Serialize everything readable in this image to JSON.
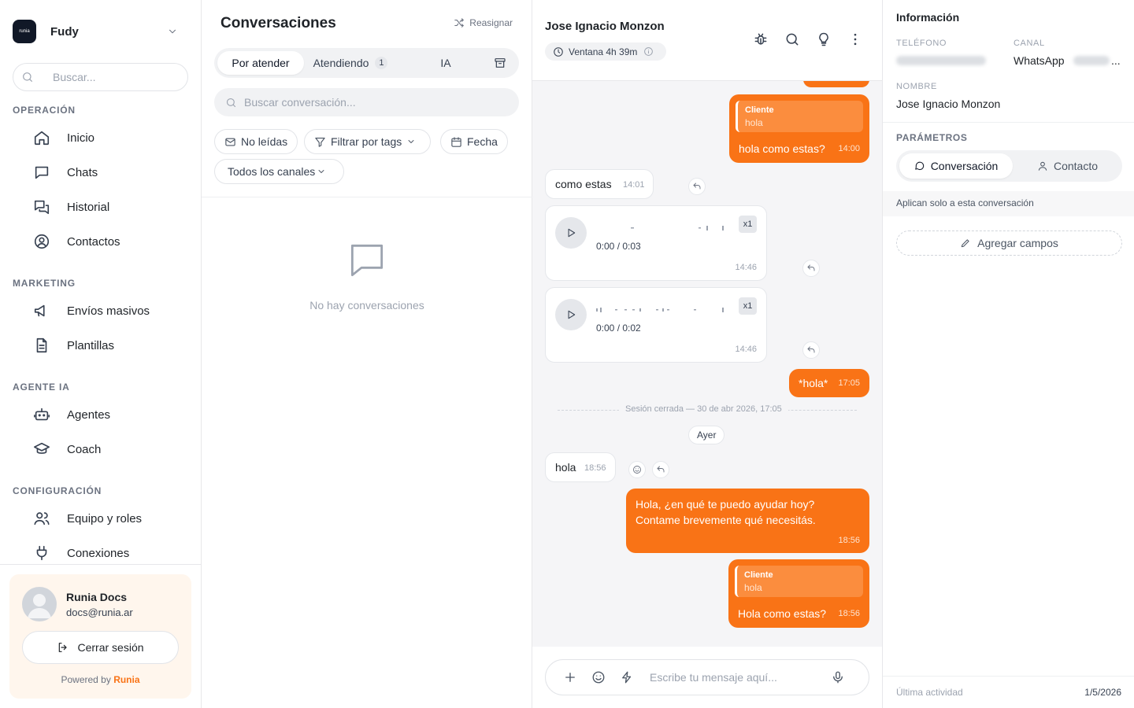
{
  "workspace": {
    "name": "Fudy",
    "logo_text": "runia"
  },
  "sidebar": {
    "search_placeholder": "Buscar...",
    "sections": {
      "operacion": "OPERACIÓN",
      "marketing": "MARKETING",
      "agente_ia": "AGENTE IA",
      "configuracion": "CONFIGURACIÓN"
    },
    "items": {
      "inicio": "Inicio",
      "chats": "Chats",
      "historial": "Historial",
      "contactos": "Contactos",
      "envios": "Envíos masivos",
      "plantillas": "Plantillas",
      "agentes": "Agentes",
      "coach": "Coach",
      "equipo": "Equipo y roles",
      "conexiones": "Conexiones"
    },
    "user": {
      "name": "Runia Docs",
      "email": "docs@runia.ar"
    },
    "logout_label": "Cerrar sesión",
    "powered_prefix": "Powered by",
    "powered_brand": "Runia"
  },
  "conversations": {
    "title": "Conversaciones",
    "reassign_label": "Reasignar",
    "tabs": {
      "por_atender": "Por atender",
      "atendiendo": "Atendiendo",
      "atendiendo_count": "1",
      "ia": "IA"
    },
    "search_placeholder": "Buscar conversación...",
    "filters": {
      "unread": "No leídas",
      "tags": "Filtrar por tags",
      "date": "Fecha",
      "channels": "Todos los canales"
    },
    "empty_text": "No hay conversaciones"
  },
  "chat": {
    "contact_name": "Jose Ignacio Monzon",
    "window_label": "Ventana 4h 39m",
    "messages": {
      "m1": {
        "quote_author": "Cliente",
        "quote_text": "hola",
        "text": "hola como estas?",
        "time": "14:00"
      },
      "m2": {
        "text": "como estas",
        "time": "14:01"
      },
      "a1": {
        "progress": "0:00 / 0:03",
        "speed": "x1",
        "time": "14:46"
      },
      "a2": {
        "progress": "0:00 / 0:02",
        "speed": "x1",
        "time": "14:46"
      },
      "m3": {
        "text": "*hola*",
        "time": "17:05"
      },
      "session": "Sesión cerrada — 30 de abr 2026, 17:05",
      "day": "Ayer",
      "m4": {
        "text": "hola",
        "time": "18:56"
      },
      "m5": {
        "line1": "Hola, ¿en qué te puedo ayudar hoy?",
        "line2": "Contame brevemente qué necesitás.",
        "time": "18:56"
      },
      "m6": {
        "quote_author": "Cliente",
        "quote_text": "hola",
        "text": "Hola como estas?",
        "time": "18:56"
      }
    },
    "composer_placeholder": "Escribe tu mensaje aquí..."
  },
  "info": {
    "title": "Información",
    "phone_label": "TELÉFONO",
    "channel_label": "CANAL",
    "channel_value": "WhatsApp",
    "channel_ellipsis": "...",
    "name_label": "NOMBRE",
    "name_value": "Jose Ignacio Monzon",
    "params_label": "PARÁMETROS",
    "tab_conversation": "Conversación",
    "tab_contact": "Contacto",
    "note": "Aplican solo a esta conversación",
    "add_fields": "Agregar campos",
    "last_activity_label": "Última actividad",
    "last_activity_value": "1/5/2026"
  },
  "colors": {
    "accent": "#f97316",
    "accent_light": "#fff6ed",
    "quote_bg": "#fb8d3e"
  }
}
